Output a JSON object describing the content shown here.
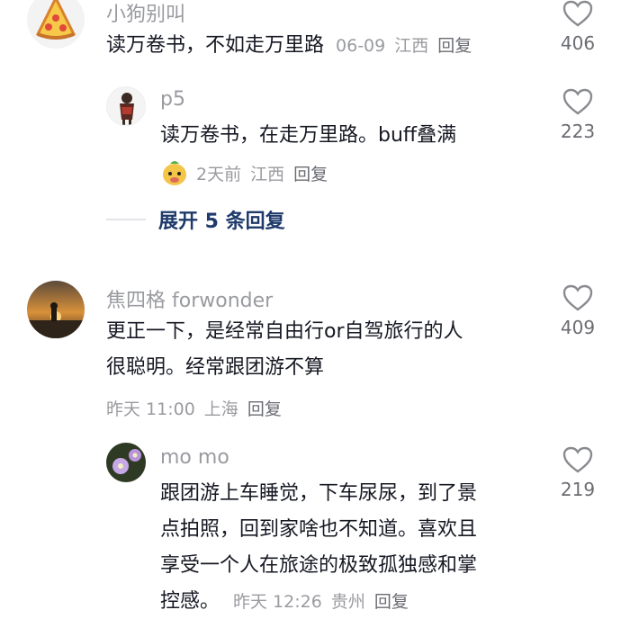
{
  "comments": [
    {
      "username": "小狗别叫",
      "text_lines": [
        "读万卷书，不如走万里路"
      ],
      "date": "06-09",
      "location": "江西",
      "reply": "回复",
      "likes": "406",
      "avatar_icon": "pizza-icon"
    },
    {
      "username": "p5",
      "text_lines": [
        "读万卷书，在走万里路。buff叠满"
      ],
      "date": "2天前",
      "location": "江西",
      "reply": "回复",
      "likes": "223",
      "avatar_icon": "silhouette-avatar"
    },
    {
      "username": "焦四格 forwonder",
      "text_lines": [
        "更正一下，是经常自由行or自驾旅行的人",
        "很聪明。经常跟团游不算"
      ],
      "date": "昨天 11:00",
      "location": "上海",
      "reply": "回复",
      "likes": "409",
      "avatar_icon": "sunset-photo-avatar"
    },
    {
      "username": "mo mo",
      "text_lines": [
        "跟团游上车睡觉，下车尿尿，到了景",
        "点拍照，回到家啥也不知道。喜欢且",
        "享受一个人在旅途的极致孤独感和掌",
        "控感。"
      ],
      "date": "昨天 12:26",
      "location": "贵州",
      "reply": "回复",
      "likes": "219",
      "avatar_icon": "flower-photo-avatar"
    }
  ],
  "expand_replies": "展开 5 条回复",
  "colors": {
    "text": "#161823",
    "secondary": "#9a9ba0",
    "expand": "#1e3a6a"
  }
}
